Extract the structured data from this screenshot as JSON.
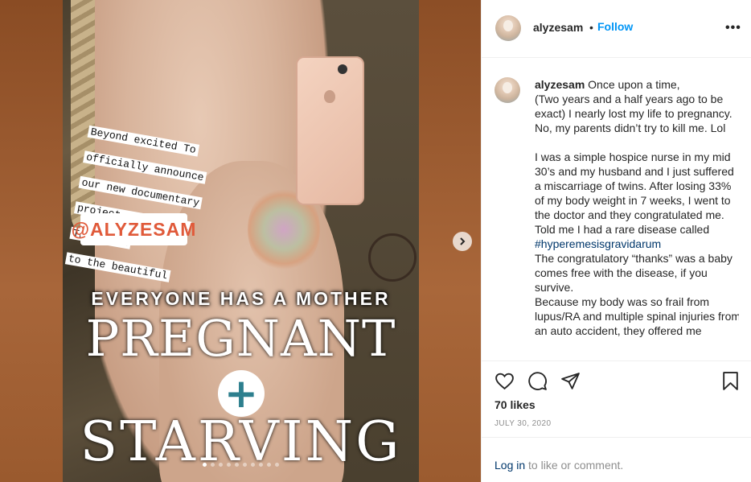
{
  "media": {
    "note_lines": [
      "Beyond excited To",
      "officially announce",
      "our new documentary",
      "project. A special",
      "Thank you",
      "to the beautiful"
    ],
    "handle_tag": "@ALYZESAM",
    "headline": "EVERYONE HAS A MOTHER",
    "title_top": "PREGNANT",
    "plus": "+",
    "title_bottom": "STARVING",
    "carousel": {
      "count": 10,
      "active": 1
    }
  },
  "post": {
    "username": "alyzesam",
    "dot": "•",
    "follow_label": "Follow",
    "more_label": "•••",
    "caption_paragraphs": [
      "Once upon a time,\n(Two years and a half years ago to be exact) I nearly lost my life to pregnancy. No, my parents didn’t try to kill me. Lol",
      "",
      "I was a simple hospice nurse in my mid 30’s and my husband and I just suffered a miscarriage of twins. After losing 33% of my body weight in 7 weeks, I went to the doctor and they congratulated me. Told me I had a rare disease called"
    ],
    "caption_hashtag": "#hyperemesisgravidarum",
    "caption_after": [
      "The congratulatory “thanks” was a baby comes free with the disease, if you survive.",
      "Because my body was so frail from lupus/RA and multiple spinal injuries from an auto accident, they offered me"
    ],
    "likes": "70 likes",
    "date": "JULY 30, 2020",
    "login_link": "Log in",
    "login_text": " to like or comment."
  },
  "icons": [
    "heart-icon",
    "comment-icon",
    "share-icon",
    "bookmark-icon",
    "chevron-right-icon",
    "more-icon"
  ]
}
